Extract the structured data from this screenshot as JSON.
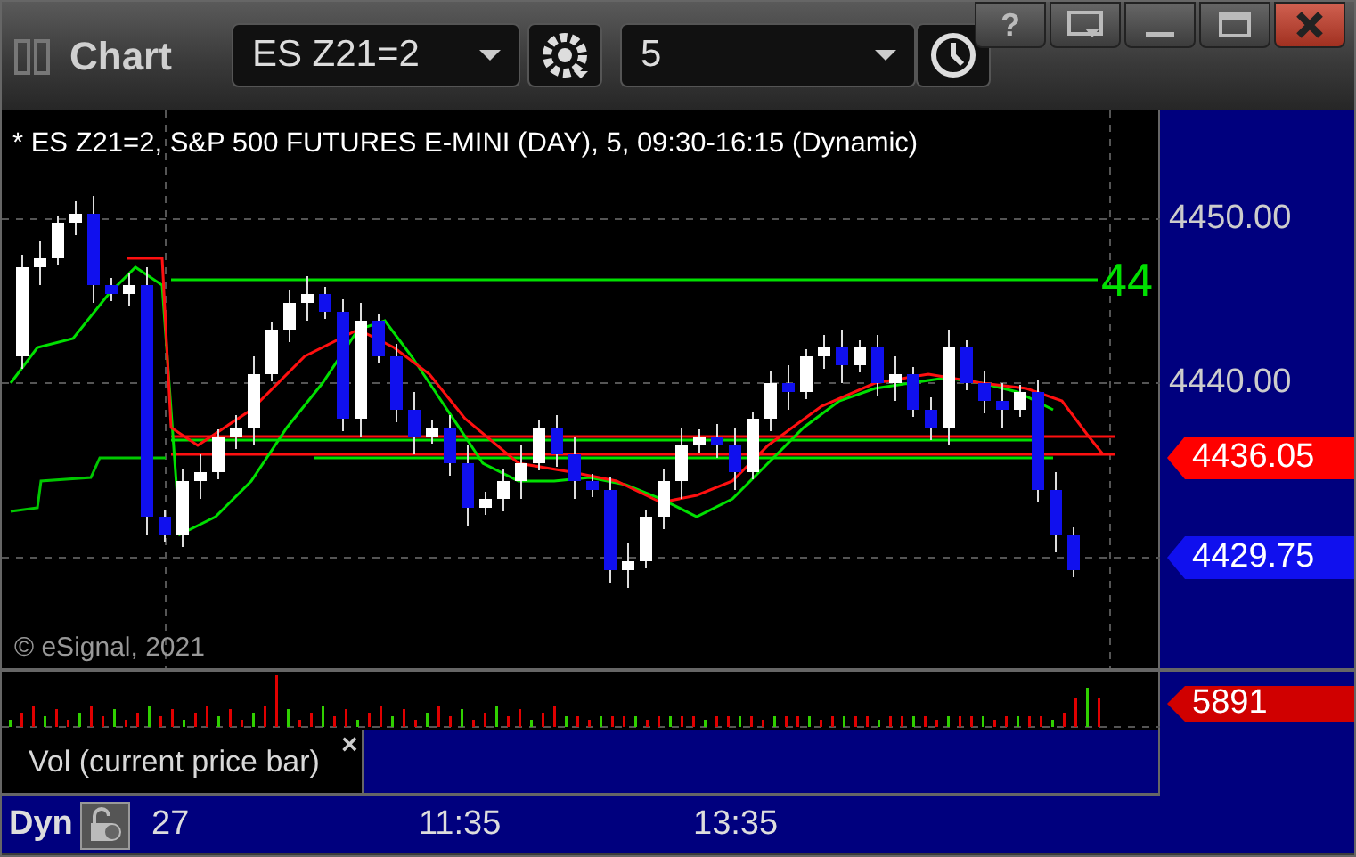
{
  "window": {
    "title": "Chart",
    "help": "?"
  },
  "toolbar": {
    "symbol": {
      "value": "ES Z21=2"
    },
    "interval": {
      "value": "5"
    }
  },
  "chart": {
    "header": "* ES Z21=2, S&P 500 FUTURES E-MINI (DAY), 5, 09:30-16:15 (Dynamic)",
    "level_label": "44",
    "copyright": "© eSignal, 2021",
    "price_axis": {
      "ticks": [
        "4450.00",
        "4440.00"
      ],
      "tags": [
        {
          "text": "4436.05",
          "color": "#ff0000"
        },
        {
          "text": "4429.75",
          "color": "#1010ee"
        }
      ]
    }
  },
  "volume": {
    "tag": {
      "text": "5891",
      "color": "#d00000"
    },
    "label": "Vol (current price bar)",
    "close": "×"
  },
  "time_axis": {
    "mode": "Dyn",
    "labels": [
      "27",
      "11:35",
      "13:35"
    ]
  }
}
